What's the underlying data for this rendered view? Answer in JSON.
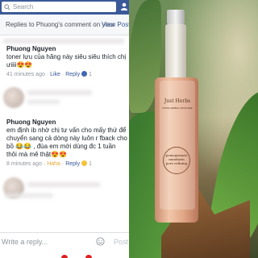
{
  "header": {
    "search_placeholder": "Search"
  },
  "reply_bar": {
    "title": "Replies to Phuong's comment on your",
    "view_post": "View Post"
  },
  "comments": [
    {
      "name": "Phuong Nguyen",
      "text": "toner lựu của hãng này siêu siêu thích chị ưiiii😍😍",
      "time": "41 minutes ago",
      "like": "Like",
      "reply": "Reply",
      "reactions": "1"
    },
    {
      "name": "Phuong Nguyen",
      "text": "em định ib nhờ chị tư vấn cho mấy thứ để chuyển sang cả dòng này luôn r fback cho bồ 😂😂 , đùa em mới dùng đc 1 tuần thôi mà mê thật😍😍",
      "time": "8 minutes ago",
      "haha": "Haha",
      "reply": "Reply",
      "reactions": "1"
    }
  ],
  "footer": {
    "write_placeholder": "Write a reply...",
    "post": "Post"
  },
  "product": {
    "brand": "Just Herbs",
    "subtitle": "PURE HERBAL SKINCARE",
    "name_line1": "pomegranate",
    "name_line2": "mandarin",
    "name_line3": "pore refining"
  }
}
